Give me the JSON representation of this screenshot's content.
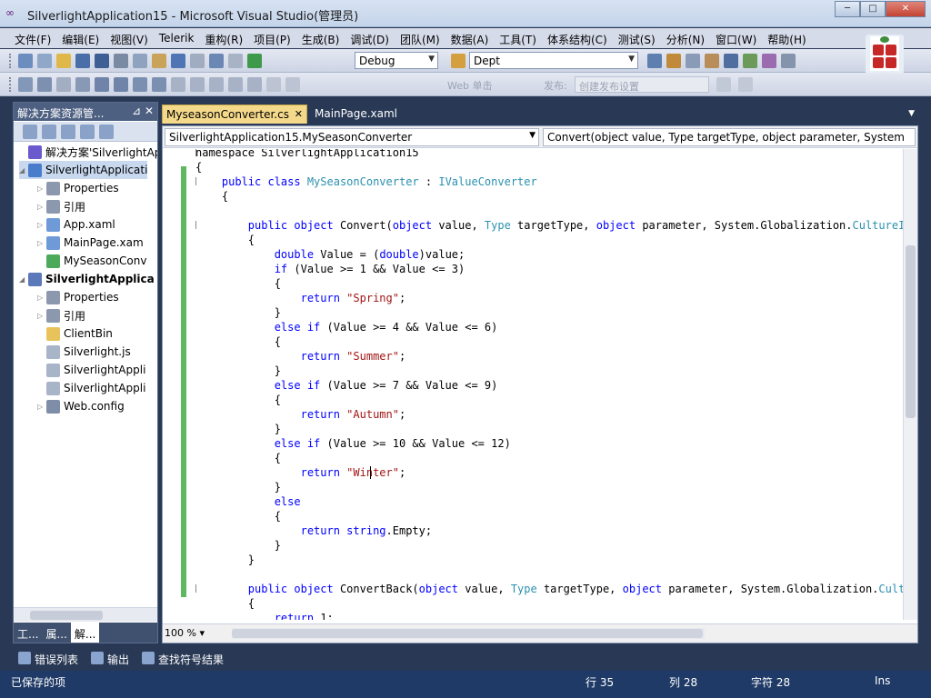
{
  "window": {
    "title": "SilverlightApplication15 - Microsoft Visual Studio(管理员)",
    "buttons": [
      "─",
      "□",
      "✕"
    ]
  },
  "menu": [
    "文件(F)",
    "编辑(E)",
    "视图(V)",
    "Telerik",
    "重构(R)",
    "项目(P)",
    "生成(B)",
    "调试(D)",
    "团队(M)",
    "数据(A)",
    "工具(T)",
    "体系结构(C)",
    "测试(S)",
    "分析(N)",
    "窗口(W)",
    "帮助(H)"
  ],
  "toolbar": {
    "config": "Debug",
    "find": "Dept",
    "web_label": "Web 单击",
    "publish_label": "发布:",
    "publish_field": "创建发布设置"
  },
  "solution_explorer": {
    "title": "解决方案资源管...",
    "pin": "⊿",
    "close": "✕",
    "items": [
      {
        "label": "解决方案'SilverlightAp",
        "expander": "",
        "color": "#6a5acd",
        "bold": false
      },
      {
        "label": "SilverlightApplicati",
        "expander": "◢",
        "color": "#4a7ccc",
        "bold": false
      },
      {
        "label": "Properties",
        "expander": "▷",
        "color": "#8c98ad",
        "bold": false
      },
      {
        "label": "引用",
        "expander": "▷",
        "color": "#8c98ad",
        "bold": false
      },
      {
        "label": "App.xaml",
        "expander": "▷",
        "color": "#6f9ad8",
        "bold": false
      },
      {
        "label": "MainPage.xam",
        "expander": "▷",
        "color": "#6f9ad8",
        "bold": false
      },
      {
        "label": "MySeasonConv",
        "expander": "",
        "color": "#4caa5a",
        "bold": false
      },
      {
        "label": "SilverlightApplica",
        "expander": "◢",
        "color": "#5b78b8",
        "bold": true
      },
      {
        "label": "Properties",
        "expander": "▷",
        "color": "#8c98ad",
        "bold": false
      },
      {
        "label": "引用",
        "expander": "▷",
        "color": "#8c98ad",
        "bold": false
      },
      {
        "label": "ClientBin",
        "expander": "",
        "color": "#e8c25a",
        "bold": false
      },
      {
        "label": "Silverlight.js",
        "expander": "",
        "color": "#a8b4c8",
        "bold": false
      },
      {
        "label": "SilverlightAppli",
        "expander": "",
        "color": "#a8b4c8",
        "bold": false
      },
      {
        "label": "SilverlightAppli",
        "expander": "",
        "color": "#a8b4c8",
        "bold": false
      },
      {
        "label": "Web.config",
        "expander": "▷",
        "color": "#7e8ea8",
        "bold": false
      }
    ],
    "tabs": [
      "工...",
      "属...",
      "解..."
    ]
  },
  "tabs": [
    {
      "label": "MyseasonConverter.cs",
      "close": "✕"
    },
    {
      "label": "MainPage.xaml"
    }
  ],
  "editor": {
    "class_dropdown": "SilverlightApplication15.MySeasonConverter",
    "member_dropdown": "Convert(object value, Type targetType, object parameter, System",
    "zoom": "100 %",
    "lines": [
      [
        [
          "",
          "namespace SilverlightApplication15"
        ]
      ],
      [
        [
          "",
          "{"
        ]
      ],
      [
        [
          "",
          "    "
        ],
        [
          "kw",
          "public class "
        ],
        [
          "ty",
          "MySeasonConverter"
        ],
        [
          "",
          " : "
        ],
        [
          "ty",
          "IValueConverter"
        ]
      ],
      [
        [
          "",
          "    {"
        ]
      ],
      [
        [
          "",
          ""
        ]
      ],
      [
        [
          "",
          "        "
        ],
        [
          "kw",
          "public object "
        ],
        [
          "",
          "Convert("
        ],
        [
          "kw",
          "object "
        ],
        [
          "",
          "value, "
        ],
        [
          "ty",
          "Type "
        ],
        [
          "",
          "targetType, "
        ],
        [
          "kw",
          "object "
        ],
        [
          "",
          "parameter, System.Globalization."
        ],
        [
          "ty",
          "CultureInfo"
        ]
      ],
      [
        [
          "",
          "        {"
        ]
      ],
      [
        [
          "",
          "            "
        ],
        [
          "kw",
          "double "
        ],
        [
          "",
          "Value = ("
        ],
        [
          "kw",
          "double"
        ],
        [
          "",
          ")value;"
        ]
      ],
      [
        [
          "",
          "            "
        ],
        [
          "kw",
          "if "
        ],
        [
          "",
          "(Value >= 1 && Value <= 3)"
        ]
      ],
      [
        [
          "",
          "            {"
        ]
      ],
      [
        [
          "",
          "                "
        ],
        [
          "kw",
          "return "
        ],
        [
          "st",
          "\"Spring\""
        ],
        [
          "",
          ";"
        ]
      ],
      [
        [
          "",
          "            }"
        ]
      ],
      [
        [
          "",
          "            "
        ],
        [
          "kw",
          "else if "
        ],
        [
          "",
          "(Value >= 4 && Value <= 6)"
        ]
      ],
      [
        [
          "",
          "            {"
        ]
      ],
      [
        [
          "",
          "                "
        ],
        [
          "kw",
          "return "
        ],
        [
          "st",
          "\"Summer\""
        ],
        [
          "",
          ";"
        ]
      ],
      [
        [
          "",
          "            }"
        ]
      ],
      [
        [
          "",
          "            "
        ],
        [
          "kw",
          "else if "
        ],
        [
          "",
          "(Value >= 7 && Value <= 9)"
        ]
      ],
      [
        [
          "",
          "            {"
        ]
      ],
      [
        [
          "",
          "                "
        ],
        [
          "kw",
          "return "
        ],
        [
          "st",
          "\"Autumn\""
        ],
        [
          "",
          ";"
        ]
      ],
      [
        [
          "",
          "            }"
        ]
      ],
      [
        [
          "",
          "            "
        ],
        [
          "kw",
          "else if "
        ],
        [
          "",
          "(Value >= 10 && Value <= 12)"
        ]
      ],
      [
        [
          "",
          "            {"
        ]
      ],
      [
        [
          "",
          "                "
        ],
        [
          "kw",
          "return "
        ],
        [
          "st",
          "\"Winter\""
        ],
        [
          "",
          ";"
        ]
      ],
      [
        [
          "",
          "            }"
        ]
      ],
      [
        [
          "",
          "            "
        ],
        [
          "kw",
          "else"
        ]
      ],
      [
        [
          "",
          "            {"
        ]
      ],
      [
        [
          "",
          "                "
        ],
        [
          "kw",
          "return string"
        ],
        [
          "",
          ".Empty;"
        ]
      ],
      [
        [
          "",
          "            }"
        ]
      ],
      [
        [
          "",
          "        }"
        ]
      ],
      [
        [
          "",
          ""
        ]
      ],
      [
        [
          "",
          "        "
        ],
        [
          "kw",
          "public object "
        ],
        [
          "",
          "ConvertBack("
        ],
        [
          "kw",
          "object "
        ],
        [
          "",
          "value, "
        ],
        [
          "ty",
          "Type "
        ],
        [
          "",
          "targetType, "
        ],
        [
          "kw",
          "object "
        ],
        [
          "",
          "parameter, System.Globalization."
        ],
        [
          "ty",
          "Culture"
        ]
      ],
      [
        [
          "",
          "        {"
        ]
      ],
      [
        [
          "",
          "            "
        ],
        [
          "kw",
          "return "
        ],
        [
          "",
          "1;"
        ]
      ]
    ]
  },
  "output_tabs": [
    "错误列表",
    "输出",
    "查找符号结果"
  ],
  "status": {
    "message": "已保存的项",
    "line": "行 35",
    "col": "列 28",
    "char": "字符 28",
    "mode": "Ins"
  }
}
